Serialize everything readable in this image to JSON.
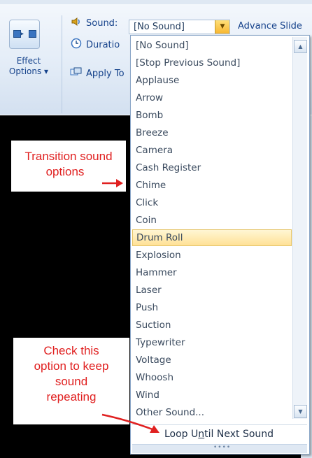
{
  "ribbon": {
    "effect_options_line1": "Effect",
    "effect_options_line2": "Options ▾",
    "sound_label": "Sound:",
    "sound_value": "[No Sound]",
    "duration_label": "Duratio",
    "apply_label": "Apply To",
    "advance_slide_label": "Advance Slide"
  },
  "dropdown": {
    "items": [
      "[No Sound]",
      "[Stop Previous Sound]",
      "Applause",
      "Arrow",
      "Bomb",
      "Breeze",
      "Camera",
      "Cash Register",
      "Chime",
      "Click",
      "Coin",
      "Drum Roll",
      "Explosion",
      "Hammer",
      "Laser",
      "Push",
      "Suction",
      "Typewriter",
      "Voltage",
      "Whoosh",
      "Wind",
      "Other Sound..."
    ],
    "highlighted": "Drum Roll",
    "loop_option_pre": "Loop U",
    "loop_option_ul": "n",
    "loop_option_post": "til Next Sound",
    "loop_checked": false
  },
  "callouts": {
    "transition_line1": "Transition sound",
    "transition_line2": "options",
    "check_line1": "Check this",
    "check_line2": "option to keep",
    "check_line3": "sound",
    "check_line4": "repeating"
  },
  "colors": {
    "callout_text": "#e02020",
    "highlight": "#ffe196",
    "ribbon_text": "#15428b"
  }
}
